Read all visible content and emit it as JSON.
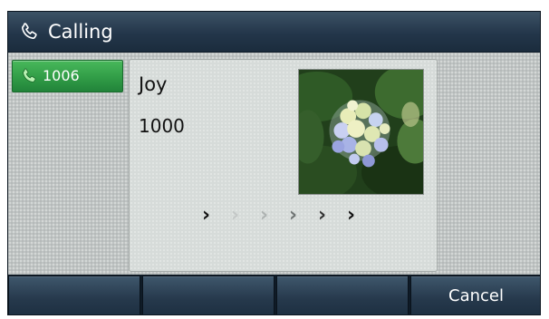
{
  "titlebar": {
    "icon": "phone-handset-icon",
    "title": "Calling"
  },
  "line_key": {
    "icon": "phone-handset-icon",
    "label": "1006",
    "color": "#2f9a45"
  },
  "call": {
    "name": "Joy",
    "number": "1000",
    "avatar": "hydrangea-flower-photo",
    "progress_arrows": 6,
    "progress_active": [
      1,
      4,
      5,
      6
    ]
  },
  "softkeys": [
    {
      "label": ""
    },
    {
      "label": ""
    },
    {
      "label": ""
    },
    {
      "label": "Cancel"
    }
  ],
  "colors": {
    "titlebar": "#23364a",
    "background": "#bfc4c3",
    "panel": "#d6dbd9",
    "softkey": "#26394c"
  }
}
